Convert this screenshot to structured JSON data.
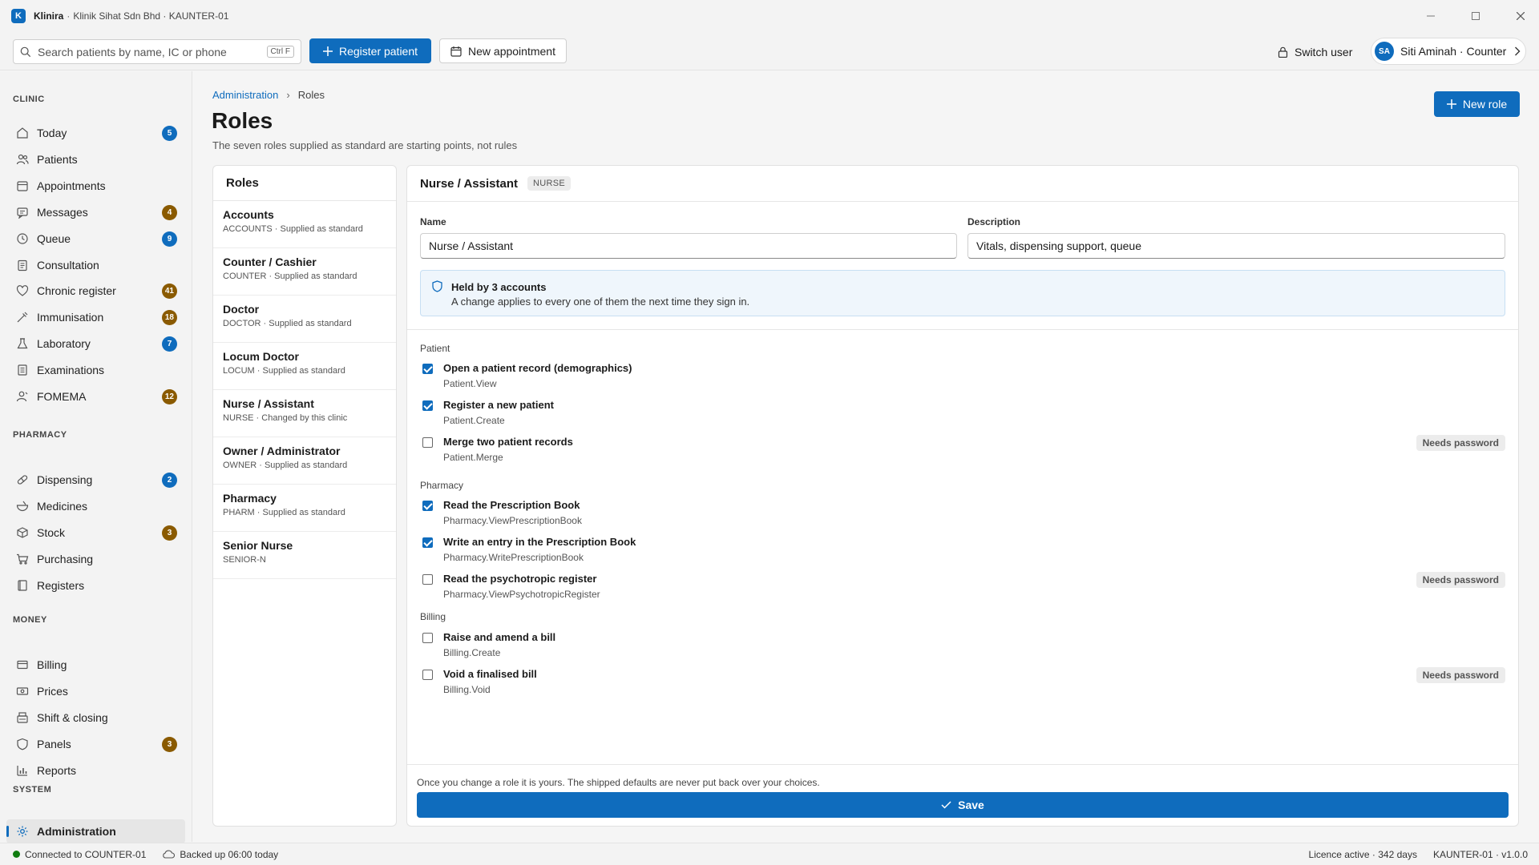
{
  "titlebar": {
    "app_name": "Klinira",
    "logo_letter": "K",
    "separator": "·",
    "context": "Klinik Sihat Sdn Bhd · KAUNTER-01"
  },
  "command_bar": {
    "search_placeholder": "Search patients by name, IC or phone",
    "search_shortcut": "Ctrl F",
    "register_patient_label": "Register patient",
    "new_appointment_label": "New appointment",
    "switch_user_label": "Switch user",
    "user_initials": "SA",
    "user_label": "Siti Aminah · Counter"
  },
  "sidebar": {
    "sections": [
      {
        "title": "CLINIC",
        "items": [
          {
            "label": "Today",
            "icon": "home-icon",
            "badge": "5",
            "badge_color": "blue"
          },
          {
            "label": "Patients",
            "icon": "people-icon",
            "badge": ""
          },
          {
            "label": "Appointments",
            "icon": "calendar-icon",
            "badge": ""
          },
          {
            "label": "Messages",
            "icon": "chat-icon",
            "badge": "4",
            "badge_color": "amber"
          },
          {
            "label": "Queue",
            "icon": "clock-icon",
            "badge": "9",
            "badge_color": "blue"
          },
          {
            "label": "Consultation",
            "icon": "clipboard-icon",
            "badge": ""
          },
          {
            "label": "Chronic register",
            "icon": "heart-icon",
            "badge": "41",
            "badge_color": "amber"
          },
          {
            "label": "Immunisation",
            "icon": "syringe-icon",
            "badge": "18",
            "badge_color": "amber"
          },
          {
            "label": "Laboratory",
            "icon": "flask-icon",
            "badge": "7",
            "badge_color": "blue"
          },
          {
            "label": "Examinations",
            "icon": "document-icon",
            "badge": ""
          },
          {
            "label": "FOMEMA",
            "icon": "person-icon",
            "badge": "12",
            "badge_color": "amber"
          }
        ]
      },
      {
        "title": "PHARMACY",
        "items": [
          {
            "label": "Dispensing",
            "icon": "pill-icon",
            "badge": "2",
            "badge_color": "blue"
          },
          {
            "label": "Medicines",
            "icon": "bowl-icon",
            "badge": ""
          },
          {
            "label": "Stock",
            "icon": "box-icon",
            "badge": "3",
            "badge_color": "amber"
          },
          {
            "label": "Purchasing",
            "icon": "cart-icon",
            "badge": ""
          },
          {
            "label": "Registers",
            "icon": "book-icon",
            "badge": ""
          }
        ]
      },
      {
        "title": "MONEY",
        "items": [
          {
            "label": "Billing",
            "icon": "bill-icon",
            "badge": ""
          },
          {
            "label": "Prices",
            "icon": "money-icon",
            "badge": ""
          },
          {
            "label": "Shift & closing",
            "icon": "register-icon",
            "badge": ""
          },
          {
            "label": "Panels",
            "icon": "shield-icon",
            "badge": "3",
            "badge_color": "amber"
          },
          {
            "label": "Reports",
            "icon": "bar-chart-icon",
            "badge": ""
          }
        ]
      },
      {
        "title": "SYSTEM",
        "items": [
          {
            "label": "Administration",
            "icon": "gear-icon",
            "badge": "",
            "active": true
          }
        ]
      }
    ]
  },
  "main": {
    "breadcrumb_parent": "Administration",
    "breadcrumb_separator": "›",
    "breadcrumb_current": "Roles",
    "title": "Roles",
    "subtitle": "The seven roles supplied as standard are starting points, not rules",
    "new_role_label": "New role"
  },
  "roles_list": {
    "header": "Roles",
    "items": [
      {
        "name": "Accounts",
        "meta": "ACCOUNTS · Supplied as standard"
      },
      {
        "name": "Counter / Cashier",
        "meta": "COUNTER · Supplied as standard"
      },
      {
        "name": "Doctor",
        "meta": "DOCTOR · Supplied as standard"
      },
      {
        "name": "Locum Doctor",
        "meta": "LOCUM · Supplied as standard"
      },
      {
        "name": "Nurse / Assistant",
        "meta": "NURSE · Changed by this clinic"
      },
      {
        "name": "Owner / Administrator",
        "meta": "OWNER · Supplied as standard"
      },
      {
        "name": "Pharmacy",
        "meta": "PHARM · Supplied as standard"
      },
      {
        "name": "Senior Nurse",
        "meta": "SENIOR-N"
      }
    ]
  },
  "detail": {
    "title": "Nurse / Assistant",
    "code": "NURSE",
    "name_label": "Name",
    "name_value": "Nurse / Assistant",
    "description_label": "Description",
    "description_value": "Vitals, dispensing support, queue",
    "info_title": "Held by 3 accounts",
    "info_text": "A change applies to every one of them the next time they sign in.",
    "groups": [
      {
        "name": "Patient",
        "permissions": [
          {
            "title": "Open a patient record (demographics)",
            "code": "Patient.View",
            "checked": true,
            "needs_password": ""
          },
          {
            "title": "Register a new patient",
            "code": "Patient.Create",
            "checked": true,
            "needs_password": ""
          },
          {
            "title": "Merge two patient records",
            "code": "Patient.Merge",
            "checked": false,
            "needs_password": "Needs password"
          }
        ]
      },
      {
        "name": "Pharmacy",
        "permissions": [
          {
            "title": "Read the Prescription Book",
            "code": "Pharmacy.ViewPrescriptionBook",
            "checked": true,
            "needs_password": ""
          },
          {
            "title": "Write an entry in the Prescription Book",
            "code": "Pharmacy.WritePrescriptionBook",
            "checked": true,
            "needs_password": ""
          },
          {
            "title": "Read the psychotropic register",
            "code": "Pharmacy.ViewPsychotropicRegister",
            "checked": false,
            "needs_password": "Needs password"
          }
        ]
      },
      {
        "name": "Billing",
        "permissions": [
          {
            "title": "Raise and amend a bill",
            "code": "Billing.Create",
            "checked": false,
            "needs_password": ""
          },
          {
            "title": "Void a finalised bill",
            "code": "Billing.Void",
            "checked": false,
            "needs_password": "Needs password"
          }
        ]
      }
    ],
    "footnote": "Once you change a role it is yours. The shipped defaults are never put back over your choices.",
    "save_label": "Save"
  },
  "statusbar": {
    "connection": "Connected to COUNTER-01",
    "backup": "Backed up 06:00 today",
    "licence": "Licence active · 342 days",
    "version": "KAUNTER-01 · v1.0.0"
  },
  "colors": {
    "accent": "#0f6cbd",
    "badge_blue": "#0f6cbd",
    "badge_amber": "#8a5a00",
    "status_ok": "#107c10"
  }
}
